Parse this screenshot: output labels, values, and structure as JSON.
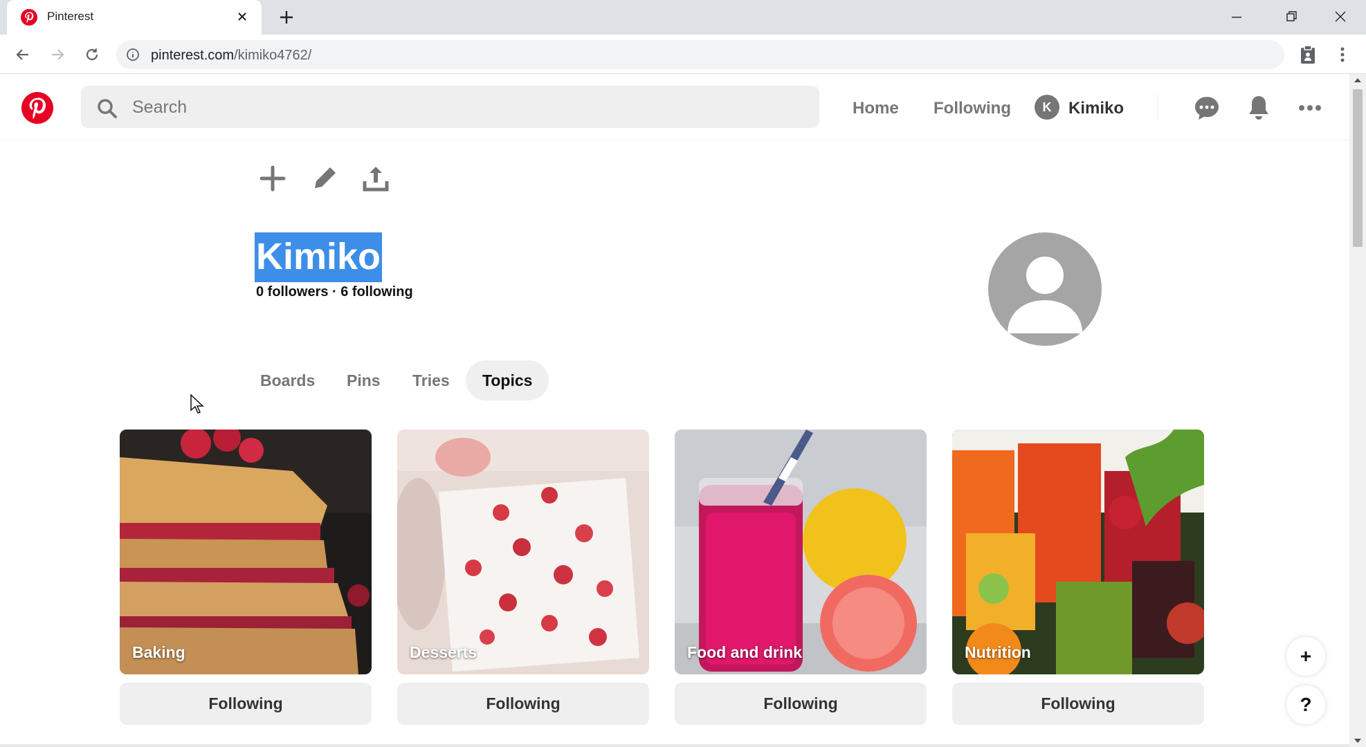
{
  "browser": {
    "tab_title": "Pinterest",
    "url_host": "pinterest.com",
    "url_path": "/kimiko4762/"
  },
  "header": {
    "search_placeholder": "Search",
    "nav_home": "Home",
    "nav_following": "Following",
    "user_initial": "K",
    "user_name": "Kimiko"
  },
  "profile": {
    "name": "Kimiko",
    "stats": "0 followers · 6 following"
  },
  "tabs": [
    {
      "label": "Boards",
      "active": false
    },
    {
      "label": "Pins",
      "active": false
    },
    {
      "label": "Tries",
      "active": false
    },
    {
      "label": "Topics",
      "active": true
    }
  ],
  "topics": [
    {
      "label": "Baking",
      "button": "Following"
    },
    {
      "label": "Desserts",
      "button": "Following"
    },
    {
      "label": "Food and drink",
      "button": "Following"
    },
    {
      "label": "Nutrition",
      "button": "Following"
    }
  ],
  "fab": {
    "add": "+",
    "help": "?"
  },
  "colors": {
    "brand": "#e60023",
    "selection": "#3d8ee8",
    "chip_bg": "#efefef"
  }
}
